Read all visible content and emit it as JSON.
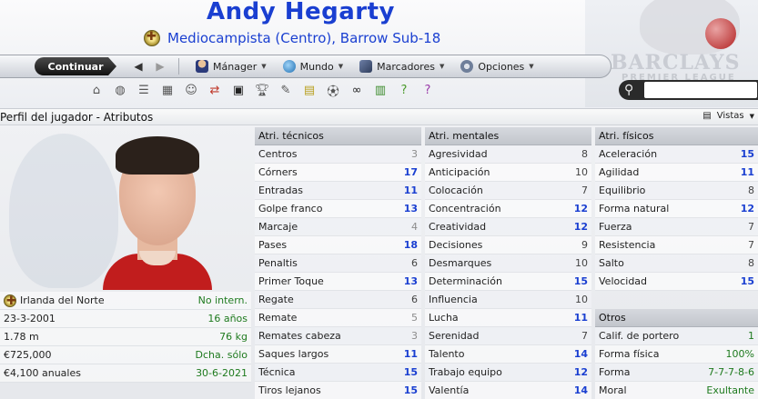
{
  "header": {
    "player_name": "Andy Hegarty",
    "role": "Mediocampista (Centro), Barrow Sub-18",
    "sponsor_brand": "BARCLAYS",
    "sponsor_sub": "PREMIER LEAGUE"
  },
  "toolbar": {
    "continue_label": "Continuar",
    "back_icon": "back-arrow-icon",
    "forward_icon": "forward-arrow-icon",
    "menus": [
      "Mánager",
      "Mundo",
      "Marcadores",
      "Opciones"
    ]
  },
  "iconrow": [
    "home-icon",
    "ball-icon",
    "list-icon",
    "calendar-icon",
    "users-icon",
    "transfer-icon",
    "tactics-icon",
    "trophy-icon",
    "scout-icon",
    "notes-icon",
    "match-icon",
    "binoculars-icon",
    "finance-icon",
    "help-icon",
    "question-icon"
  ],
  "subbar": {
    "title": "Perfil del jugador - Atributos",
    "views_label": "Vistas"
  },
  "info": [
    {
      "key": "Irlanda del Norte",
      "value": "No intern."
    },
    {
      "key": "23-3-2001",
      "value": "16 años"
    },
    {
      "key": "1.78 m",
      "value": "76 kg"
    },
    {
      "key": "€725,000",
      "value": "Dcha. sólo"
    },
    {
      "key": "€4,100 anuales",
      "value": "30-6-2021"
    }
  ],
  "technical": {
    "title": "Atri. técnicos",
    "rows": [
      {
        "name": "Centros",
        "value": "3"
      },
      {
        "name": "Córners",
        "value": "17"
      },
      {
        "name": "Entradas",
        "value": "11"
      },
      {
        "name": "Golpe franco",
        "value": "13"
      },
      {
        "name": "Marcaje",
        "value": "4"
      },
      {
        "name": "Pases",
        "value": "18"
      },
      {
        "name": "Penaltis",
        "value": "6"
      },
      {
        "name": "Primer Toque",
        "value": "13"
      },
      {
        "name": "Regate",
        "value": "6"
      },
      {
        "name": "Remate",
        "value": "5"
      },
      {
        "name": "Remates cabeza",
        "value": "3"
      },
      {
        "name": "Saques largos",
        "value": "11"
      },
      {
        "name": "Técnica",
        "value": "15"
      },
      {
        "name": "Tiros lejanos",
        "value": "15"
      }
    ]
  },
  "mental": {
    "title": "Atri. mentales",
    "rows": [
      {
        "name": "Agresividad",
        "value": "8"
      },
      {
        "name": "Anticipación",
        "value": "10"
      },
      {
        "name": "Colocación",
        "value": "7"
      },
      {
        "name": "Concentración",
        "value": "12"
      },
      {
        "name": "Creatividad",
        "value": "12"
      },
      {
        "name": "Decisiones",
        "value": "9"
      },
      {
        "name": "Desmarques",
        "value": "10"
      },
      {
        "name": "Determinación",
        "value": "15"
      },
      {
        "name": "Influencia",
        "value": "10"
      },
      {
        "name": "Lucha",
        "value": "11"
      },
      {
        "name": "Serenidad",
        "value": "7"
      },
      {
        "name": "Talento",
        "value": "14"
      },
      {
        "name": "Trabajo equipo",
        "value": "12"
      },
      {
        "name": "Valentía",
        "value": "14"
      }
    ]
  },
  "physical": {
    "title": "Atri. físicos",
    "rows": [
      {
        "name": "Aceleración",
        "value": "15"
      },
      {
        "name": "Agilidad",
        "value": "11"
      },
      {
        "name": "Equilibrio",
        "value": "8"
      },
      {
        "name": "Forma natural",
        "value": "12"
      },
      {
        "name": "Fuerza",
        "value": "7"
      },
      {
        "name": "Resistencia",
        "value": "7"
      },
      {
        "name": "Salto",
        "value": "8"
      },
      {
        "name": "Velocidad",
        "value": "15"
      }
    ]
  },
  "other": {
    "title": "Otros",
    "rows": [
      {
        "name": "Calif. de portero",
        "value": "1"
      },
      {
        "name": "Forma física",
        "value": "100%"
      },
      {
        "name": "Forma",
        "value": "7-7-7-8-6"
      },
      {
        "name": "Moral",
        "value": "Exultante"
      }
    ]
  }
}
